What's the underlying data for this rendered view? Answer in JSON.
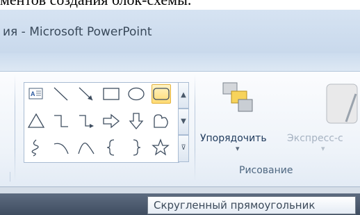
{
  "caption_fragment": "ментов создания блок-схемы.",
  "window": {
    "title": "ия - Microsoft PowerPoint"
  },
  "ribbon": {
    "shapes_gallery": {
      "items": [
        "text-box",
        "line",
        "arrow-line",
        "rectangle",
        "oval",
        "rounded-rectangle",
        "triangle",
        "elbow-connector",
        "elbow-arrow-connector",
        "right-arrow",
        "down-arrow",
        "flowchart-shape",
        "freeform-scribble",
        "arc",
        "curve",
        "left-brace",
        "right-brace",
        "star"
      ],
      "selected": "rounded-rectangle"
    },
    "arrange_button": {
      "label": "Упорядочить",
      "dropdown_glyph": "▾"
    },
    "quick_styles_button": {
      "label": "Экспресс-с",
      "dropdown_glyph": "▾"
    },
    "group_label": "Рисование"
  },
  "tooltip": {
    "text": "Скругленный прямоугольник"
  },
  "colors": {
    "ribbon_bg": "#eef3f9",
    "gallery_border": "#a9bcd3",
    "selected_highlight": "#ffdb73",
    "label_text": "#1e395b"
  }
}
